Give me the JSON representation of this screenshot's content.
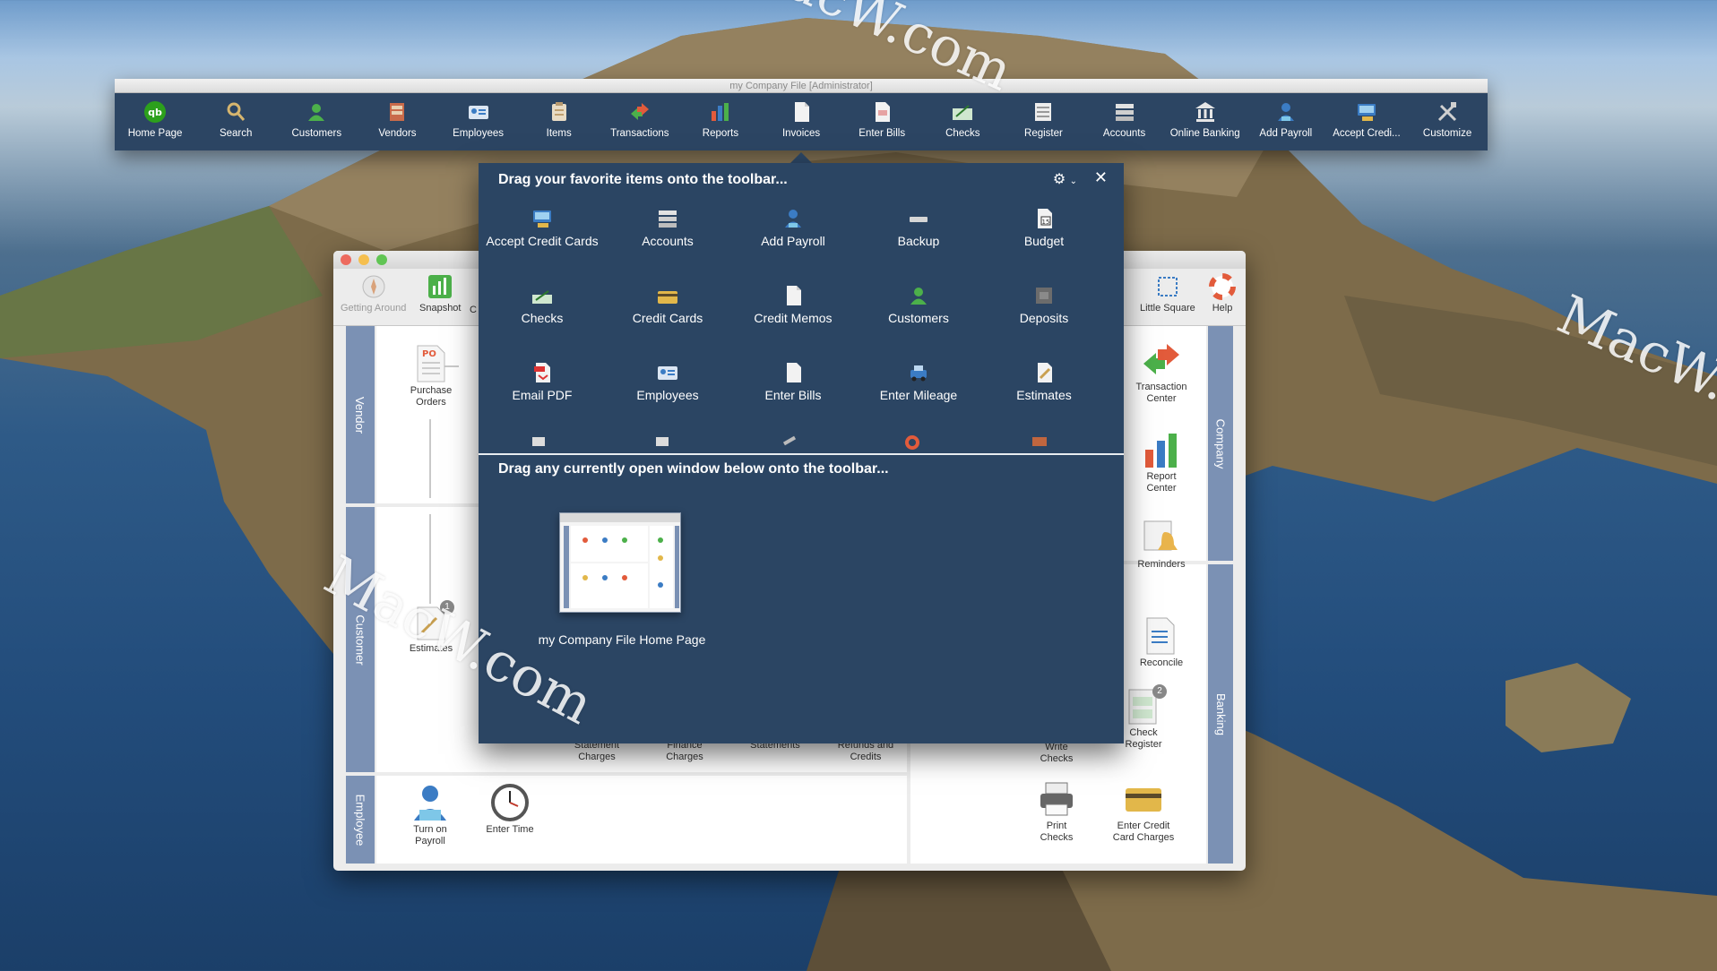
{
  "main_window": {
    "title": "my Company File [Administrator]",
    "toolbar": [
      {
        "label": "Home Page",
        "icon": "quickbooks-logo-icon"
      },
      {
        "label": "Search",
        "icon": "magnifier-icon"
      },
      {
        "label": "Customers",
        "icon": "person-icon"
      },
      {
        "label": "Vendors",
        "icon": "vendor-icon"
      },
      {
        "label": "Employees",
        "icon": "id-card-icon"
      },
      {
        "label": "Items",
        "icon": "clipboard-icon"
      },
      {
        "label": "Transactions",
        "icon": "arrows-icon"
      },
      {
        "label": "Reports",
        "icon": "bar-chart-icon"
      },
      {
        "label": "Invoices",
        "icon": "document-icon"
      },
      {
        "label": "Enter Bills",
        "icon": "bill-icon"
      },
      {
        "label": "Checks",
        "icon": "check-icon"
      },
      {
        "label": "Register",
        "icon": "register-icon"
      },
      {
        "label": "Accounts",
        "icon": "accounts-icon"
      },
      {
        "label": "Online Banking",
        "icon": "bank-icon"
      },
      {
        "label": "Add Payroll",
        "icon": "payroll-icon"
      },
      {
        "label": "Accept Credi...",
        "icon": "credit-card-terminal-icon"
      },
      {
        "label": "Customize",
        "icon": "tools-icon"
      }
    ]
  },
  "home_window": {
    "toolbar": {
      "getting_around": "Getting Around",
      "snapshot": "Snapshot",
      "clipped_c": "C",
      "little_square": "Little Square",
      "help": "Help"
    },
    "bands": {
      "vendor": "Vendor",
      "customer": "Customer",
      "employee": "Employee",
      "company": "Company",
      "banking": "Banking"
    },
    "icons": {
      "purchase_orders": "Purchase\nOrders",
      "estimates": "Estimates",
      "estimates_badge": "1",
      "turn_on_payroll": "Turn on\nPayroll",
      "enter_time": "Enter Time",
      "transaction_center": "Transaction\nCenter",
      "report_center": "Report\nCenter",
      "reminders": "Reminders",
      "reconcile": "Reconcile",
      "write_checks": "Write\nChecks",
      "check_register": "Check\nRegister",
      "check_register_badge": "2",
      "print_checks": "Print\nChecks",
      "enter_credit_card_charges": "Enter Credit\nCard Charges"
    },
    "bottom_labels": {
      "statement_charges": "Statement\nCharges",
      "finance_charges": "Finance\nCharges",
      "statements": "Statements",
      "refunds_and_credits": "Refunds and\nCredits"
    }
  },
  "popover": {
    "header": "Drag your favorite items onto the toolbar...",
    "gear": "⚙",
    "close": "✕",
    "favorites": [
      {
        "label": "Accept Credit Cards",
        "icon": "credit-card-terminal-icon"
      },
      {
        "label": "Accounts",
        "icon": "accounts-icon"
      },
      {
        "label": "Add Payroll",
        "icon": "payroll-icon"
      },
      {
        "label": "Backup",
        "icon": "backup-drive-icon"
      },
      {
        "label": "Budget",
        "icon": "calendar-doc-icon"
      },
      {
        "label": "Checks",
        "icon": "check-icon"
      },
      {
        "label": "Credit Cards",
        "icon": "credit-card-icon"
      },
      {
        "label": "Credit Memos",
        "icon": "document-icon"
      },
      {
        "label": "Customers",
        "icon": "person-icon"
      },
      {
        "label": "Deposits",
        "icon": "deposit-box-icon"
      },
      {
        "label": "Email PDF",
        "icon": "pdf-icon"
      },
      {
        "label": "Employees",
        "icon": "id-card-icon"
      },
      {
        "label": "Enter Bills",
        "icon": "bill-icon"
      },
      {
        "label": "Enter Mileage",
        "icon": "car-icon"
      },
      {
        "label": "Estimates",
        "icon": "pencil-doc-icon"
      }
    ],
    "sub_header": "Drag any currently open window below onto the toolbar...",
    "open_window_label": "my Company File Home Page"
  },
  "watermark": "MacW.com"
}
